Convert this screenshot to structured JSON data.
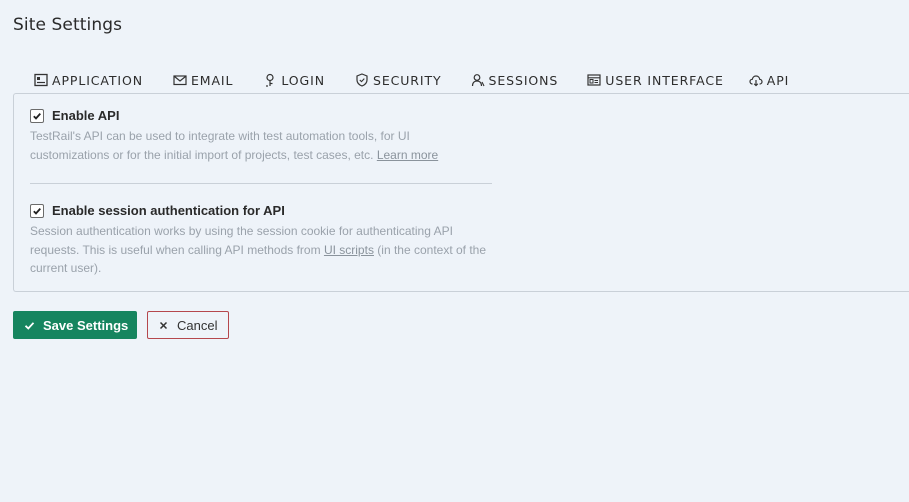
{
  "page": {
    "title": "Site Settings"
  },
  "tabs": [
    {
      "label": "APPLICATION",
      "icon": "application-icon",
      "active": false
    },
    {
      "label": "EMAIL",
      "icon": "email-icon",
      "active": false
    },
    {
      "label": "LOGIN",
      "icon": "login-key-icon",
      "active": false
    },
    {
      "label": "SECURITY",
      "icon": "shield-icon",
      "active": false
    },
    {
      "label": "SESSIONS",
      "icon": "sessions-user-icon",
      "active": false
    },
    {
      "label": "USER INTERFACE",
      "icon": "user-interface-icon",
      "active": false
    },
    {
      "label": "API",
      "icon": "cloud-api-icon",
      "active": true
    }
  ],
  "settings": {
    "enable_api": {
      "checked": true,
      "label": "Enable API",
      "description": "TestRail's API can be used to integrate with test automation tools, for UI customizations or for the initial import of projects, test cases, etc.",
      "link": "Learn more"
    },
    "session_auth": {
      "checked": true,
      "label": "Enable session authentication for API",
      "description_before": "Session authentication works by using the session cookie for authenticating API requests. This is useful when calling API methods from",
      "link": "UI scripts",
      "description_after": "(in the context of the current user)."
    }
  },
  "actions": {
    "save_label": "Save Settings",
    "cancel_label": "Cancel"
  },
  "colors": {
    "background": "#eef3f9",
    "save_button": "#16855f",
    "cancel_border": "#b5474d",
    "active_tab_underline": "#1a2c3d",
    "description_text": "#9aa2ab"
  }
}
